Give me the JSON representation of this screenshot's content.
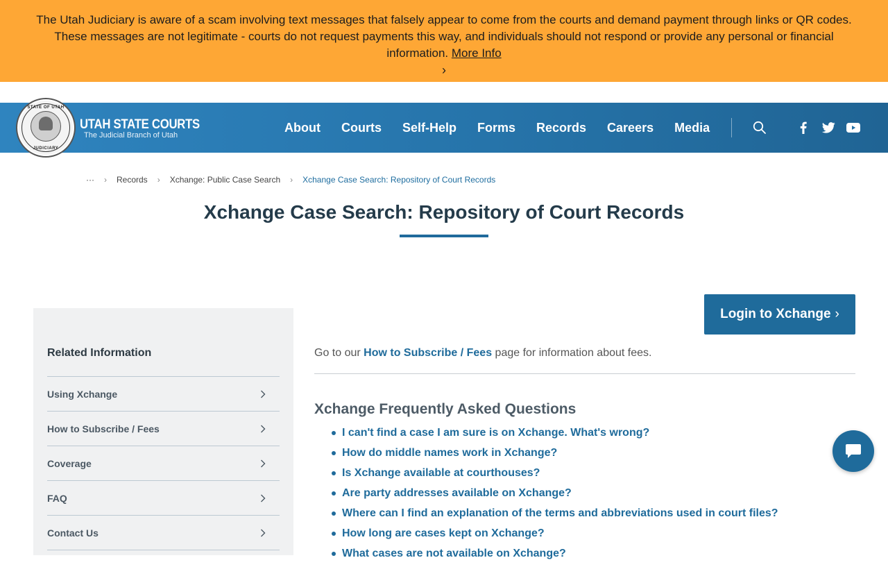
{
  "alert": {
    "text": "The Utah Judiciary is aware of a scam involving text messages that falsely appear to come from the courts and demand payment through links or QR codes. These messages are not legitimate - courts do not request payments this way, and individuals should not respond or provide any personal or financial information.",
    "link_label": "More Info",
    "link_chevron": "›"
  },
  "brand": {
    "title": "UTAH STATE COURTS",
    "subtitle": "The Judicial Branch of Utah",
    "seal_top": "STATE OF UTAH",
    "seal_bottom": "JUDICIARY"
  },
  "nav": {
    "items": [
      "About",
      "Courts",
      "Self-Help",
      "Forms",
      "Records",
      "Careers",
      "Media"
    ]
  },
  "social": [
    "facebook-icon",
    "twitter-icon",
    "youtube-icon"
  ],
  "breadcrumb": {
    "ellipsis": "···",
    "items": [
      "Records",
      "Xchange: Public Case Search"
    ],
    "current": "Xchange Case Search: Repository of Court Records"
  },
  "page": {
    "title": "Xchange Case Search: Repository of Court Records"
  },
  "sidebar": {
    "heading": "Related Information",
    "items": [
      "Using Xchange",
      "How to Subscribe / Fees",
      "Coverage",
      "FAQ",
      "Contact Us"
    ]
  },
  "main": {
    "login_label": "Login to Xchange",
    "login_chevron": "›",
    "intro_before": "Go to our ",
    "intro_link": "How to Subscribe / Fees",
    "intro_after": " page for information about fees.",
    "faq_heading": "Xchange Frequently Asked Questions",
    "faq_items": [
      "I can't find a case I am sure is on Xchange. What's wrong?",
      "How do middle names work in Xchange?",
      "Is Xchange available at courthouses?",
      "Are party addresses available on Xchange?",
      "Where can I find an explanation of the terms and abbreviations used in court files?",
      "How long are cases kept on Xchange?",
      "What cases are not available on Xchange?"
    ]
  },
  "colors": {
    "alert_bg": "#fea735",
    "header_blue": "#2674aa",
    "link_blue": "#1f6b9b",
    "title_dark": "#243b4a",
    "sidebar_bg": "#f0f1f2"
  }
}
